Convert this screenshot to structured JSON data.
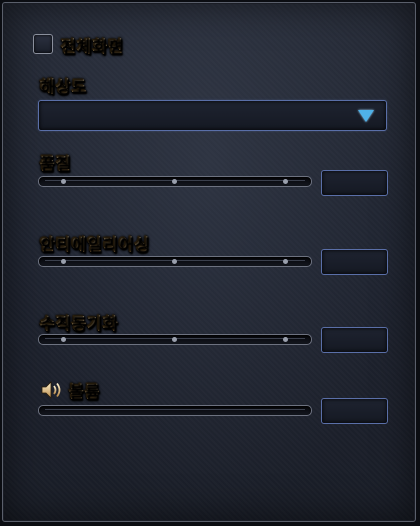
{
  "fullscreen": {
    "label": "전체화면",
    "checked": false
  },
  "resolution": {
    "label": "해상도",
    "selected": ""
  },
  "quality": {
    "label": "품질",
    "value": ""
  },
  "antialiasing": {
    "label": "안티에일리어싱",
    "value": ""
  },
  "vsync": {
    "label": "수직동기화",
    "value": ""
  },
  "volume": {
    "label": "볼륨",
    "value": ""
  },
  "icons": {
    "dropdown_arrow": "triangle-down-icon",
    "speaker": "speaker-icon"
  },
  "colors": {
    "label_gold": "#e8c489",
    "border_blue": "#5a6fa8",
    "arrow_blue": "#4fb1e8",
    "panel_bg": "#222733"
  }
}
